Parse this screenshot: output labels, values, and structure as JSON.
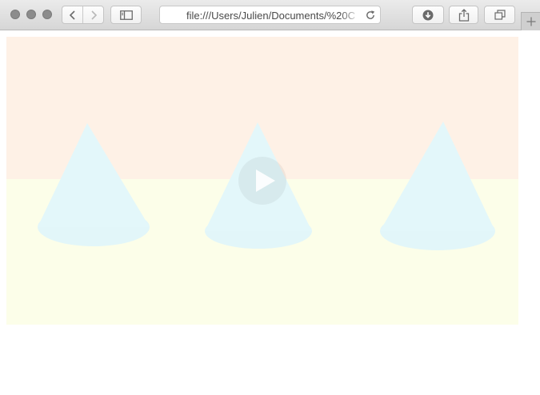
{
  "browser": {
    "address_url": "file:///Users/Julien/Documents/%20C"
  },
  "video": {
    "state": "paused",
    "colors": {
      "wall": "#fef1e6",
      "floor": "#fcfee9",
      "cone": "#e3f7fa"
    }
  },
  "icons": {
    "close": "close-icon",
    "minimize": "minimize-icon",
    "zoom": "zoom-icon",
    "back": "chevron-left-icon",
    "forward": "chevron-right-icon",
    "sidebar": "sidebar-icon",
    "reload": "reload-icon",
    "downloads": "download-icon",
    "share": "share-icon",
    "tabs": "tabs-overview-icon",
    "new_tab": "plus-icon",
    "play": "play-icon"
  }
}
